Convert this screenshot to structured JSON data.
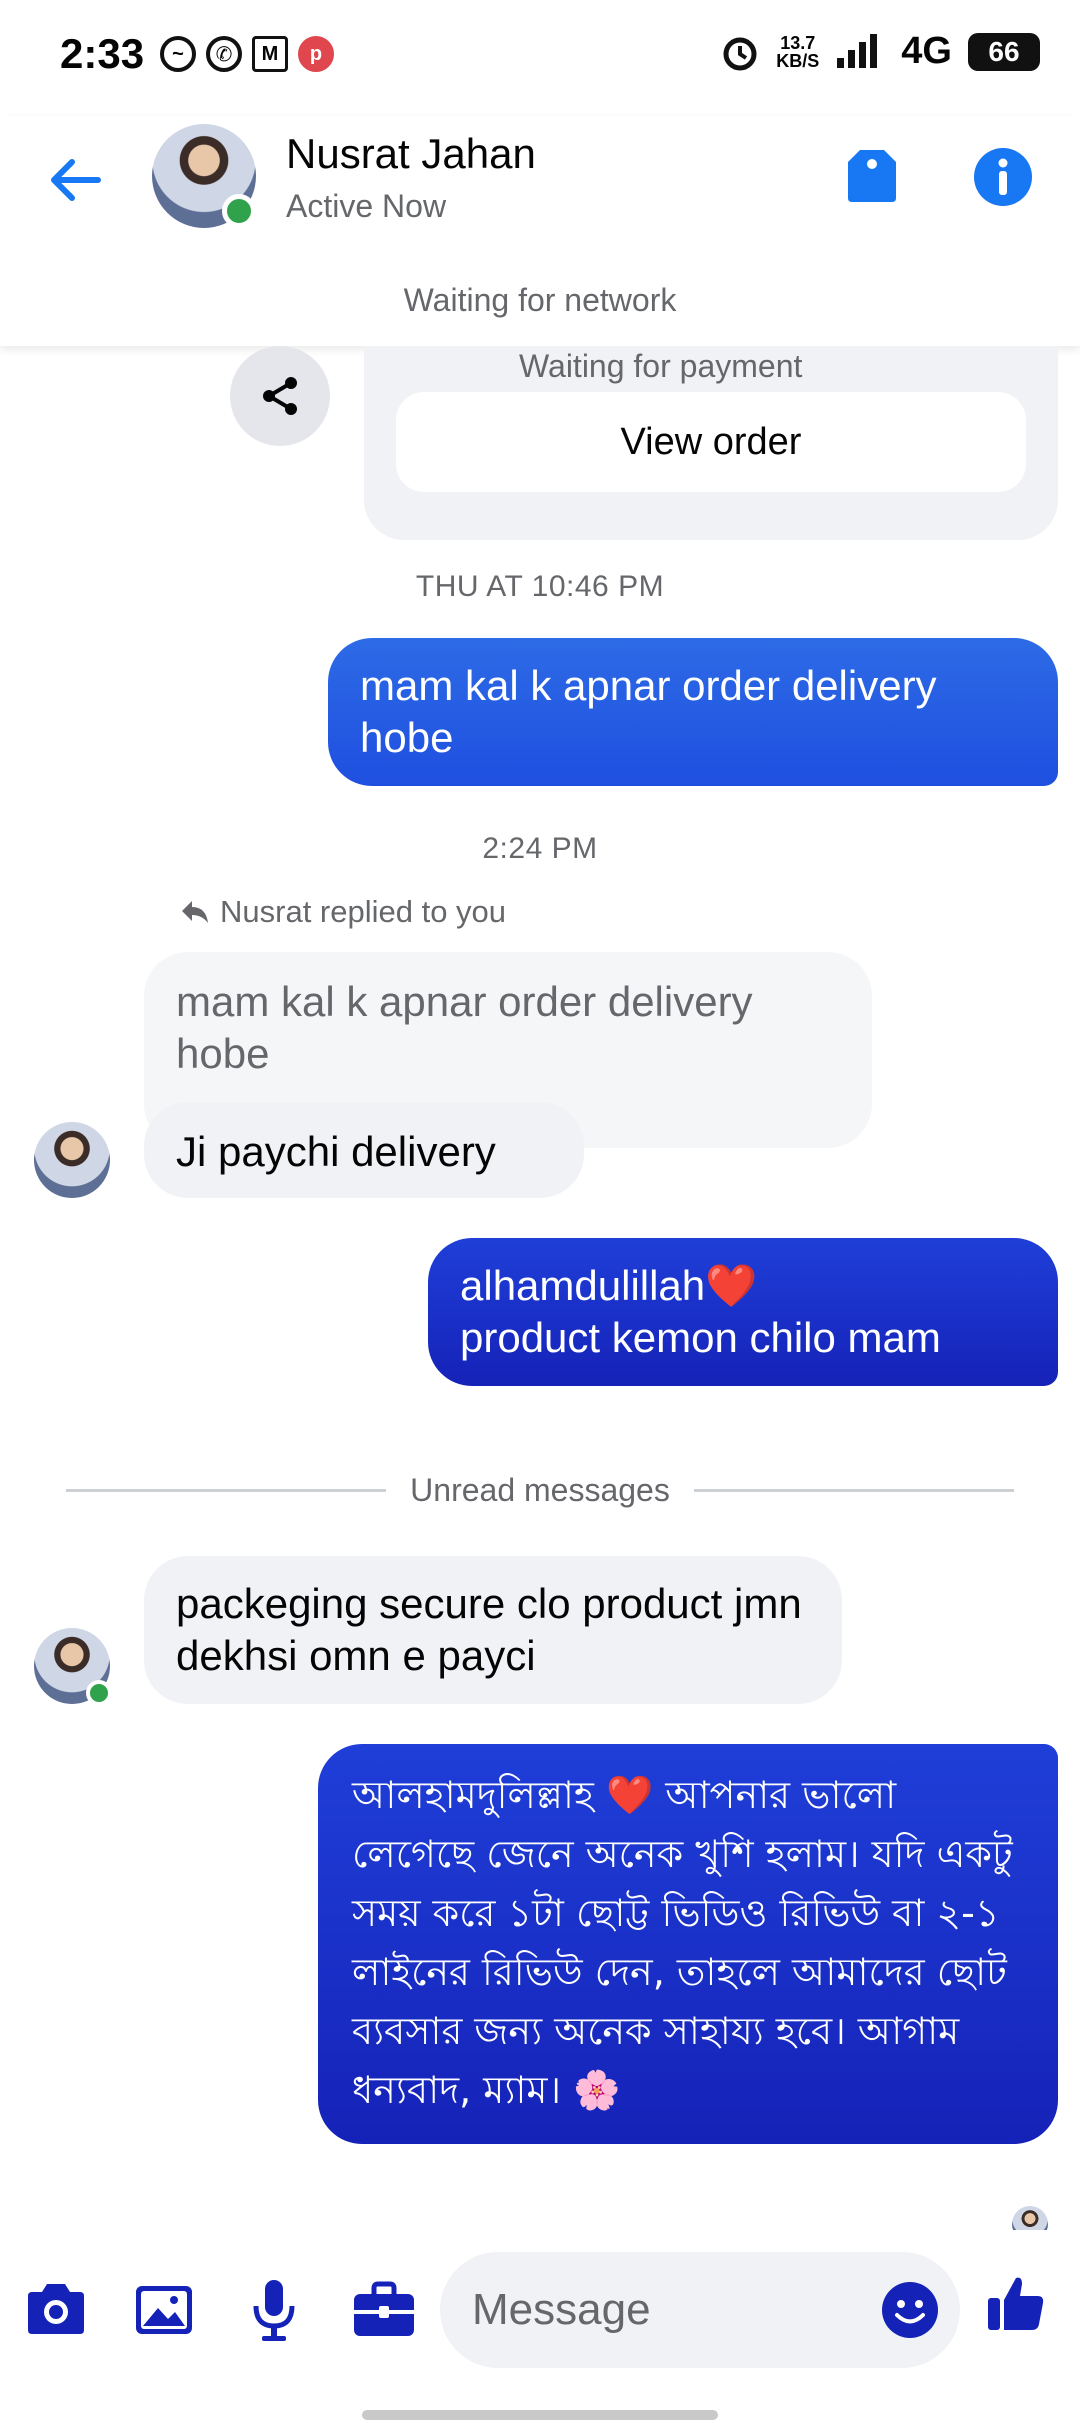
{
  "status_bar": {
    "time": "2:33",
    "app_icons": [
      "messenger-icon",
      "whatsapp-icon",
      "gmail-icon",
      "pinterest-icon"
    ],
    "net_speed_value": "13.7",
    "net_speed_unit": "KB/S",
    "network": "4G",
    "battery": "66"
  },
  "header": {
    "contact_name": "Nusrat Jahan",
    "contact_status": "Active Now",
    "network_notice": "Waiting for network"
  },
  "order_card": {
    "partial_text": "Waiting for payment",
    "view_order_label": "View order"
  },
  "messages": {
    "ts1": "THU AT 10:46 PM",
    "out1": "mam kal k apnar order delivery hobe",
    "ts2": "2:24 PM",
    "reply_label": "Nusrat replied to you",
    "quoted": "mam kal k apnar order delivery hobe",
    "in1": "Ji paychi  delivery",
    "out2_line1": "alhamdulillah❤️",
    "out2_line2": "product kemon chilo mam",
    "unread_label": "Unread messages",
    "in2": "packeging secure clo product jmn dekhsi omn e payci",
    "out3": "আলহামদুলিল্লাহ ❤️ আপনার ভালো লেগেছে জেনে অনেক খুশি হলাম। যদি একটু সময় করে ১টা ছোট্ট ভিডিও রিভিউ বা ২-১ লাইনের রিভিউ দেন, তাহলে আমাদের ছোট ব্যবসার জন্য অনেক সাহায্য হবে। আগাম ধন্যবাদ, ম্যাম। 🌸"
  },
  "composer": {
    "placeholder": "Message"
  },
  "colors": {
    "accent": "#1877f2",
    "outgoing_top": "#2d6be6",
    "outgoing_deep": "#1522b8",
    "incoming": "#f0f2f5",
    "online": "#31a24c"
  }
}
